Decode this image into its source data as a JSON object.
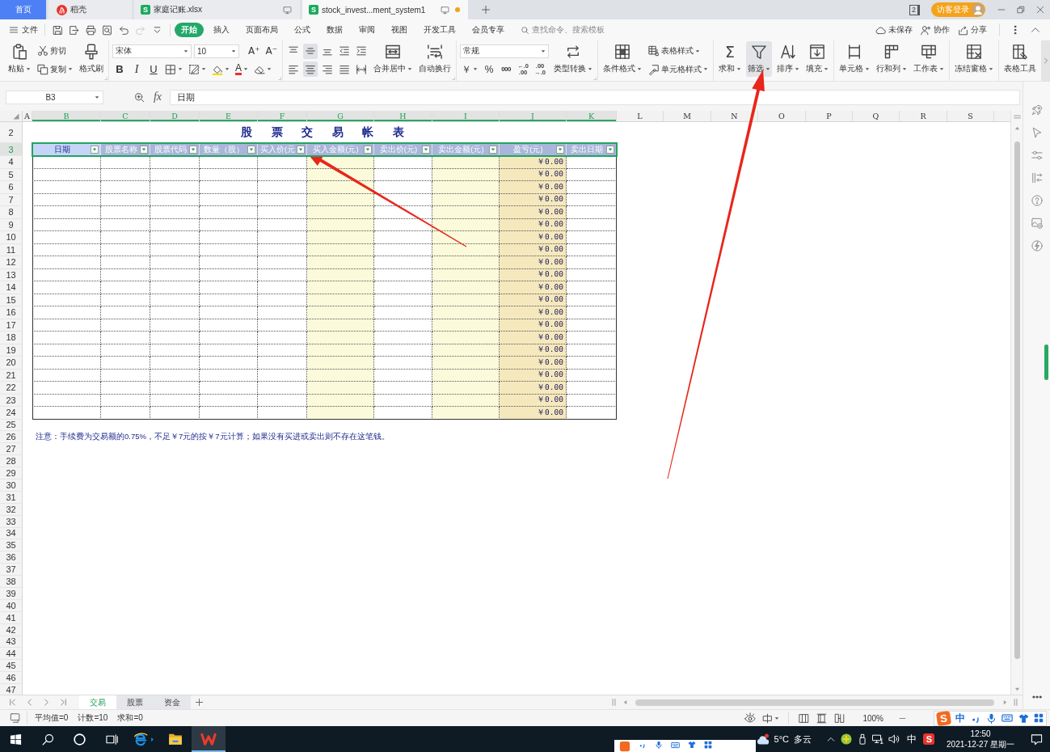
{
  "tabs": [
    {
      "kind": "home",
      "label": "首页",
      "selected": false,
      "modified": false
    },
    {
      "kind": "docer",
      "label": "稻壳",
      "selected": false,
      "modified": false
    },
    {
      "kind": "sheet",
      "badge": "S",
      "label": "家庭记账.xlsx",
      "selected": false,
      "modified": false
    },
    {
      "kind": "sheet",
      "badge": "S",
      "label": "stock_invest...ment_system1",
      "selected": true,
      "modified": true
    }
  ],
  "window_count": "2",
  "account": "访客登录",
  "menu": {
    "file": "文件",
    "quick": [
      {
        "kind": "save",
        "disabled": false
      },
      {
        "kind": "export",
        "disabled": false
      },
      {
        "kind": "print",
        "disabled": false
      },
      {
        "kind": "print-preview",
        "disabled": false
      },
      {
        "kind": "undo",
        "disabled": false
      },
      {
        "kind": "redo",
        "disabled": true
      },
      {
        "kind": "customize",
        "disabled": false
      }
    ],
    "tabs": [
      {
        "label": "开始",
        "selected": true
      },
      {
        "label": "插入",
        "selected": false
      },
      {
        "label": "页面布局",
        "selected": false
      },
      {
        "label": "公式",
        "selected": false
      },
      {
        "label": "数据",
        "selected": false
      },
      {
        "label": "审阅",
        "selected": false
      },
      {
        "label": "视图",
        "selected": false
      },
      {
        "label": "开发工具",
        "selected": false
      },
      {
        "label": "会员专享",
        "selected": false
      }
    ],
    "search": {
      "placeholder": "查找命令、搜索模板"
    },
    "actions": [
      {
        "kind": "cloud",
        "label": "未保存"
      },
      {
        "kind": "collaborate",
        "label": "协作"
      },
      {
        "kind": "share",
        "label": "分享"
      }
    ]
  },
  "ribbon": [
    {
      "launcher": true,
      "cells": [
        {
          "kind": "paste",
          "label": "粘贴",
          "dropdown": true,
          "active": false
        },
        {
          "kind": "stack",
          "rows": [
            [
              {
                "kind": "cut",
                "label": "剪切",
                "dropdown": false,
                "active": false
              }
            ],
            [
              {
                "kind": "copy",
                "label": "复制",
                "dropdown": true,
                "active": false
              }
            ]
          ]
        },
        {
          "kind": "format-painter",
          "label": "格式刷",
          "dropdown": false,
          "active": false
        }
      ]
    },
    {
      "launcher": true,
      "cells": [
        {
          "kind": "stack",
          "rows": [
            [
              {
                "kind": "font-select",
                "value": "宋体"
              },
              {
                "kind": "size-select",
                "value": "10"
              },
              {
                "kind": "grow-font",
                "glyph": "A⁺",
                "dropdown": false,
                "active": false
              },
              {
                "kind": "shrink-font",
                "glyph": "A⁻",
                "dropdown": false,
                "active": false
              }
            ],
            [
              {
                "kind": "bold",
                "glyph": "B",
                "dropdown": false,
                "active": false
              },
              {
                "kind": "italic",
                "glyph": "I",
                "dropdown": false,
                "active": false
              },
              {
                "kind": "underline",
                "glyph": "U",
                "dropdown": false,
                "active": false
              },
              {
                "kind": "borders",
                "dropdown": true,
                "active": false
              },
              {
                "kind": "draw-border",
                "dropdown": true,
                "active": false
              },
              {
                "kind": "fill-color",
                "dropdown": true,
                "active": false
              },
              {
                "kind": "font-color",
                "glyph": "A",
                "dropdown": true,
                "active": false
              },
              {
                "kind": "clear",
                "dropdown": true,
                "active": false
              }
            ]
          ]
        }
      ]
    },
    {
      "launcher": true,
      "cells": [
        {
          "kind": "stack",
          "rows": [
            [
              {
                "kind": "align-top",
                "dropdown": false,
                "active": false
              },
              {
                "kind": "align-middle",
                "dropdown": false,
                "active": true
              },
              {
                "kind": "align-bottom",
                "dropdown": false,
                "active": false
              },
              {
                "kind": "outdent",
                "dropdown": false,
                "active": false
              },
              {
                "kind": "indent",
                "dropdown": false,
                "active": false
              }
            ],
            [
              {
                "kind": "align-left",
                "dropdown": false,
                "active": false
              },
              {
                "kind": "align-center",
                "dropdown": false,
                "active": true
              },
              {
                "kind": "align-right",
                "dropdown": false,
                "active": false
              },
              {
                "kind": "justify",
                "dropdown": false,
                "active": false
              },
              {
                "kind": "distribute",
                "dropdown": false,
                "active": false
              }
            ]
          ]
        },
        {
          "kind": "merge-center",
          "label": "合并居中",
          "dropdown": true,
          "active": false
        },
        {
          "kind": "wrap-text",
          "label": "自动换行",
          "dropdown": false,
          "active": false
        }
      ]
    },
    {
      "launcher": true,
      "cells": [
        {
          "kind": "stack",
          "rows": [
            [
              {
                "kind": "format-select",
                "value": "常规"
              }
            ],
            [
              {
                "kind": "currency",
                "glyph": "￥",
                "dropdown": true,
                "active": false
              },
              {
                "kind": "percent",
                "glyph": "%",
                "dropdown": false,
                "active": false
              },
              {
                "kind": "thousands",
                "glyph": "000",
                "dropdown": false,
                "active": false
              },
              {
                "kind": "add-decimal",
                "lines": [
                  "←.0",
                  ".00"
                ],
                "dropdown": false,
                "active": false
              },
              {
                "kind": "remove-decimal",
                "lines": [
                  ".00",
                  "→.0"
                ],
                "dropdown": false,
                "active": false
              }
            ]
          ]
        },
        {
          "kind": "convert",
          "label": "类型转换",
          "dropdown": true,
          "active": false
        }
      ]
    },
    {
      "launcher": false,
      "cells": [
        {
          "kind": "conditional-format",
          "label": "条件格式",
          "dropdown": true,
          "active": false
        },
        {
          "kind": "stack",
          "rows": [
            [
              {
                "kind": "table-style",
                "label": "表格样式",
                "dropdown": true,
                "active": false
              }
            ],
            [
              {
                "kind": "cell-style",
                "label": "单元格样式",
                "dropdown": true,
                "active": false
              }
            ]
          ]
        }
      ]
    },
    {
      "launcher": false,
      "cells": [
        {
          "kind": "sum",
          "glyph": "Σ",
          "label": "求和",
          "dropdown": true,
          "active": false
        },
        {
          "kind": "filter",
          "label": "筛选",
          "dropdown": true,
          "active": true
        },
        {
          "kind": "sort",
          "label": "排序",
          "dropdown": true,
          "active": false
        },
        {
          "kind": "fill",
          "label": "填充",
          "dropdown": true,
          "active": false
        }
      ]
    },
    {
      "launcher": false,
      "cells": [
        {
          "kind": "cell",
          "label": "单元格",
          "dropdown": true,
          "active": false
        },
        {
          "kind": "rows-columns",
          "label": "行和列",
          "dropdown": true,
          "active": false
        },
        {
          "kind": "worksheet",
          "label": "工作表",
          "dropdown": true,
          "active": false
        }
      ]
    },
    {
      "launcher": false,
      "cells": [
        {
          "kind": "freeze",
          "label": "冻结窗格",
          "dropdown": true,
          "active": false
        }
      ]
    },
    {
      "launcher": false,
      "cells": [
        {
          "kind": "table-tools",
          "label": "表格工具",
          "dropdown": false,
          "active": false
        }
      ]
    }
  ],
  "formula_bar": {
    "cell": "B3",
    "fx": "fx",
    "value": "日期"
  },
  "columns": [
    {
      "label": "A",
      "selected": false
    },
    {
      "label": "B",
      "selected": true
    },
    {
      "label": "C",
      "selected": true
    },
    {
      "label": "D",
      "selected": true
    },
    {
      "label": "E",
      "selected": true
    },
    {
      "label": "F",
      "selected": true
    },
    {
      "label": "G",
      "selected": true
    },
    {
      "label": "H",
      "selected": true
    },
    {
      "label": "I",
      "selected": true
    },
    {
      "label": "J",
      "selected": true
    },
    {
      "label": "K",
      "selected": true
    },
    {
      "label": "L",
      "selected": false
    },
    {
      "label": "M",
      "selected": false
    },
    {
      "label": "N",
      "selected": false
    },
    {
      "label": "O",
      "selected": false
    },
    {
      "label": "P",
      "selected": false
    },
    {
      "label": "Q",
      "selected": false
    },
    {
      "label": "R",
      "selected": false
    },
    {
      "label": "S",
      "selected": false
    }
  ],
  "rows": [
    {
      "label": "2",
      "selected": false
    },
    {
      "label": "3",
      "selected": true
    },
    {
      "label": "4",
      "selected": false
    },
    {
      "label": "5",
      "selected": false
    },
    {
      "label": "6",
      "selected": false
    },
    {
      "label": "7",
      "selected": false
    },
    {
      "label": "8",
      "selected": false
    },
    {
      "label": "9",
      "selected": false
    },
    {
      "label": "10",
      "selected": false
    },
    {
      "label": "11",
      "selected": false
    },
    {
      "label": "12",
      "selected": false
    },
    {
      "label": "13",
      "selected": false
    },
    {
      "label": "14",
      "selected": false
    },
    {
      "label": "15",
      "selected": false
    },
    {
      "label": "16",
      "selected": false
    },
    {
      "label": "17",
      "selected": false
    },
    {
      "label": "18",
      "selected": false
    },
    {
      "label": "19",
      "selected": false
    },
    {
      "label": "20",
      "selected": false
    },
    {
      "label": "21",
      "selected": false
    },
    {
      "label": "22",
      "selected": false
    },
    {
      "label": "23",
      "selected": false
    },
    {
      "label": "24",
      "selected": false
    },
    {
      "label": "25",
      "selected": false
    },
    {
      "label": "26",
      "selected": false
    },
    {
      "label": "27",
      "selected": false
    },
    {
      "label": "28",
      "selected": false
    },
    {
      "label": "29",
      "selected": false
    },
    {
      "label": "30",
      "selected": false
    },
    {
      "label": "31",
      "selected": false
    },
    {
      "label": "32",
      "selected": false
    },
    {
      "label": "33",
      "selected": false
    },
    {
      "label": "34",
      "selected": false
    },
    {
      "label": "35",
      "selected": false
    },
    {
      "label": "36",
      "selected": false
    },
    {
      "label": "37",
      "selected": false
    },
    {
      "label": "38",
      "selected": false
    },
    {
      "label": "39",
      "selected": false
    },
    {
      "label": "40",
      "selected": false
    },
    {
      "label": "41",
      "selected": false
    },
    {
      "label": "42",
      "selected": false
    },
    {
      "label": "43",
      "selected": false
    },
    {
      "label": "44",
      "selected": false
    },
    {
      "label": "45",
      "selected": false
    },
    {
      "label": "46",
      "selected": false
    },
    {
      "label": "47",
      "selected": false
    }
  ],
  "table": {
    "title": "股 票 交 易 帐 表",
    "headers": [
      {
        "label": "日期",
        "kind": "input",
        "selected": true
      },
      {
        "label": "股票名称",
        "kind": "input",
        "selected": false
      },
      {
        "label": "股票代码",
        "kind": "input",
        "selected": false
      },
      {
        "label": "数量（股）",
        "kind": "input",
        "selected": false
      },
      {
        "label": "买入价(元",
        "kind": "input",
        "selected": false
      },
      {
        "label": "买入金额(元)",
        "kind": "computed",
        "selected": false
      },
      {
        "label": "卖出价(元)",
        "kind": "input",
        "selected": false
      },
      {
        "label": "卖出金额(元)",
        "kind": "computed",
        "selected": false
      },
      {
        "label": "盈亏(元)",
        "kind": "result",
        "selected": false
      },
      {
        "label": "卖出日期",
        "kind": "input",
        "selected": false
      }
    ],
    "rows": [
      {
        "profit": "￥0.00"
      },
      {
        "profit": "￥0.00"
      },
      {
        "profit": "￥0.00"
      },
      {
        "profit": "￥0.00"
      },
      {
        "profit": "￥0.00"
      },
      {
        "profit": "￥0.00"
      },
      {
        "profit": "￥0.00"
      },
      {
        "profit": "￥0.00"
      },
      {
        "profit": "￥0.00"
      },
      {
        "profit": "￥0.00"
      },
      {
        "profit": "￥0.00"
      },
      {
        "profit": "￥0.00"
      },
      {
        "profit": "￥0.00"
      },
      {
        "profit": "￥0.00"
      },
      {
        "profit": "￥0.00"
      },
      {
        "profit": "￥0.00"
      },
      {
        "profit": "￥0.00"
      },
      {
        "profit": "￥0.00"
      },
      {
        "profit": "￥0.00"
      },
      {
        "profit": "￥0.00"
      },
      {
        "profit": "￥0.00"
      }
    ],
    "note": "注意：手续费为交易额的0.75%，不足￥7元的按￥7元计算；如果没有买进或卖出则不存在这笔钱。"
  },
  "sheet_tabs": [
    {
      "label": "交易",
      "selected": true
    },
    {
      "label": "股票",
      "selected": false
    },
    {
      "label": "资金",
      "selected": false
    }
  ],
  "status_bar": {
    "stats": [
      "平均值=0",
      "计数=10",
      "求和=0"
    ],
    "zoom": "100%"
  },
  "ime_toolbar": {
    "logo": "S",
    "mode": "中"
  },
  "taskbar": {
    "weather": "5°C",
    "condition": "多云",
    "input": "中",
    "ime_logo": "S",
    "time": "12:50",
    "date": "2021-12-27 星期一"
  }
}
